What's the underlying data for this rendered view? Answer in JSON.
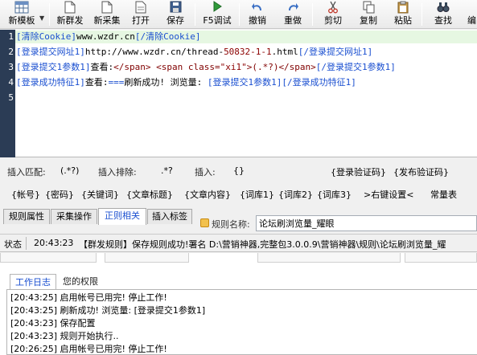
{
  "toolbar": {
    "new_template": "新模板",
    "new_publish": "新群发",
    "new_collect": "新采集",
    "open": "打开",
    "save": "保存",
    "f5_debug": "F5调试",
    "undo": "撤销",
    "redo": "重做",
    "cut": "剪切",
    "copy": "复制",
    "paste": "粘贴",
    "find": "查找",
    "more": "编"
  },
  "editor": {
    "line_numbers": [
      "1",
      "2",
      "3",
      "4",
      "5"
    ],
    "lines": [
      {
        "t1": "[清除Cookie]",
        "t2": "www.wzdr.cn",
        "t3": "[/清除Cookie]"
      },
      {
        "t1": "[登录提交网址1]",
        "t2": "http://www.wzdr.cn/thread-",
        "t3": "50832-1-1",
        "t4": ".html",
        "t5": "[/登录提交网址1]"
      },
      {
        "t1": "[登录提交1参数1]",
        "t2": "查看:",
        "t3": "</span> <span class=",
        "t4": "\"xi1\"",
        "t5": ">(.*?)</span>",
        "t6": "[/登录提交1参数1]"
      },
      {
        "t1": "[登录成功特征1]",
        "t2": "查看:",
        "t3": "===",
        "t4": "刷新成功! 浏览量: ",
        "t5": "[登录提交1参数1]",
        "t6": "[/登录成功特征1]"
      }
    ]
  },
  "insert_panel": {
    "match_label": "插入匹配:",
    "match_value": "(.*?)",
    "exclude_label": "插入排除:",
    "exclude_value": ".*?",
    "insert_label": "插入:",
    "insert_value": "{}",
    "captcha_login": "{登录验证码}",
    "captcha_publish": "{发布验证码}",
    "tokens": [
      "{帐号}",
      "{密码}",
      "{关键词}",
      "{文章标题}",
      "{文章内容}",
      "{词库1}",
      "{词库2}",
      "{词库3}"
    ],
    "wildcard_settings": ">右键设置<",
    "constants_table": "常量表"
  },
  "tabs": {
    "rule_properties": "规则属性",
    "publish_ops": "采集操作",
    "regex_related": "正则相关",
    "insert_tags": "插入标签"
  },
  "rule_name": {
    "label": "规则名称:",
    "value": "论坛刷浏览量_耀眼"
  },
  "status": {
    "label": "状态",
    "time": "20:43:23",
    "message": "【群发规则】保存规则成功!署名 D:\\营销神器,完整包3.0.0.9\\营销神器\\规则\\论坛刷浏览量_耀"
  },
  "log": {
    "tab_work_log": "工作日志",
    "tab_permissions": "您的权限",
    "entries": [
      "[20:43:25] 启用帐号已用完! 停止工作!",
      "[20:43:25] 刷新成功! 浏览量: [登录提交1参数1]",
      "[20:43:23] 保存配置",
      "[20:43:23] 规则开始执行..",
      "[20:26:25] 启用帐号已用完! 停止工作!"
    ]
  }
}
